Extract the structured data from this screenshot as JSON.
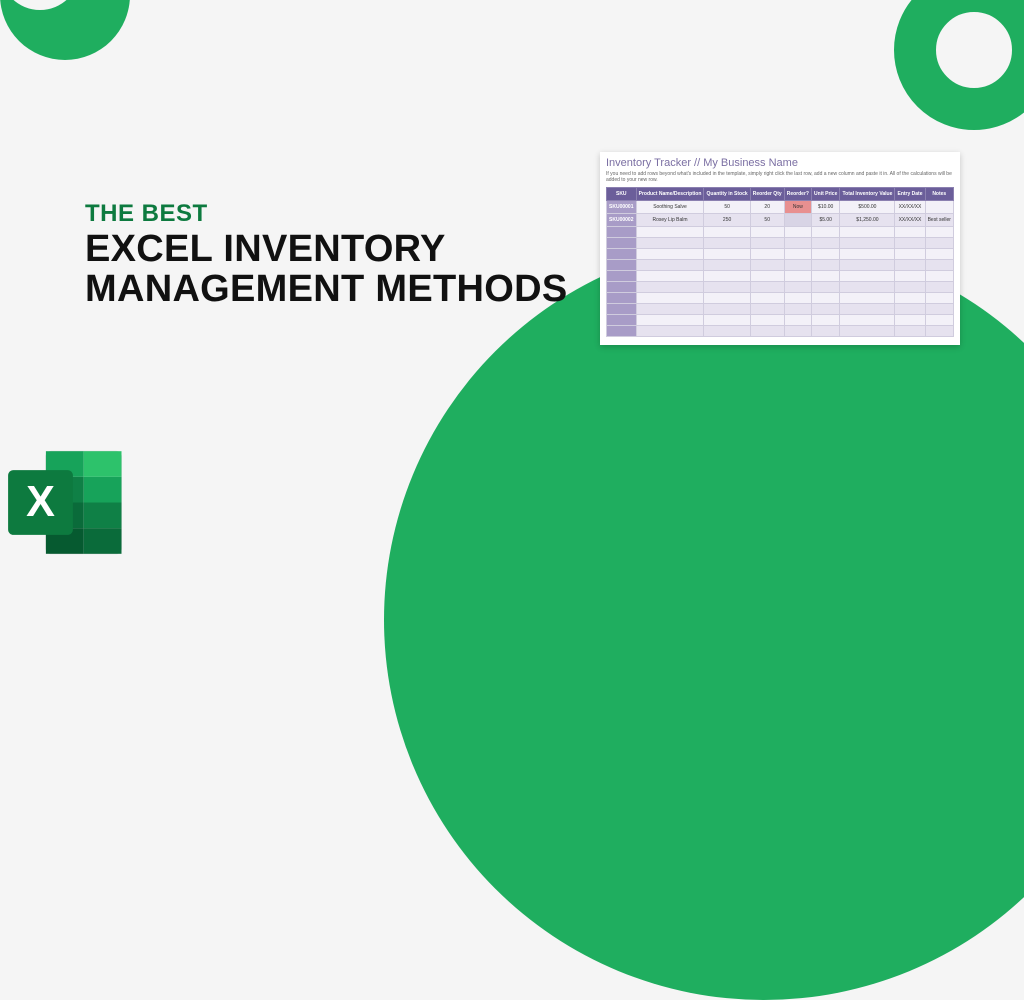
{
  "headline": {
    "eyebrow": "THE BEST",
    "line1": "EXCEL INVENTORY",
    "line2": "MANAGEMENT METHODS"
  },
  "colors": {
    "green": "#1fae5f",
    "dark_green": "#0d7a3f",
    "purple": "#6b5e9a"
  },
  "spreadsheet": {
    "title": "Inventory Tracker // My Business Name",
    "subtitle": "If you need to add rows beyond what's included in the template, simply right click the last row, add a new column and paste it in. All of the calculations will be added to your new row.",
    "headers": [
      "SKU",
      "Product Name/Description",
      "Quantity in Stock",
      "Reorder Qty",
      "Reorder?",
      "Unit Price",
      "Total Inventory Value",
      "Entry Date",
      "Notes"
    ],
    "rows": [
      {
        "sku": "SKU00001",
        "name": "Soothing Salve",
        "qty": "50",
        "reorder_qty": "20",
        "reorder": "Now",
        "reorder_class": "now",
        "unit": "$10.00",
        "total": "$500.00",
        "date": "XX/XX/XX",
        "notes": ""
      },
      {
        "sku": "SKU00002",
        "name": "Rosey Lip Balm",
        "qty": "250",
        "reorder_qty": "50",
        "reorder": "",
        "reorder_class": "later",
        "unit": "$5.00",
        "total": "$1,250.00",
        "date": "XX/XX/XX",
        "notes": "Best seller"
      }
    ],
    "blank_rows": 10
  }
}
